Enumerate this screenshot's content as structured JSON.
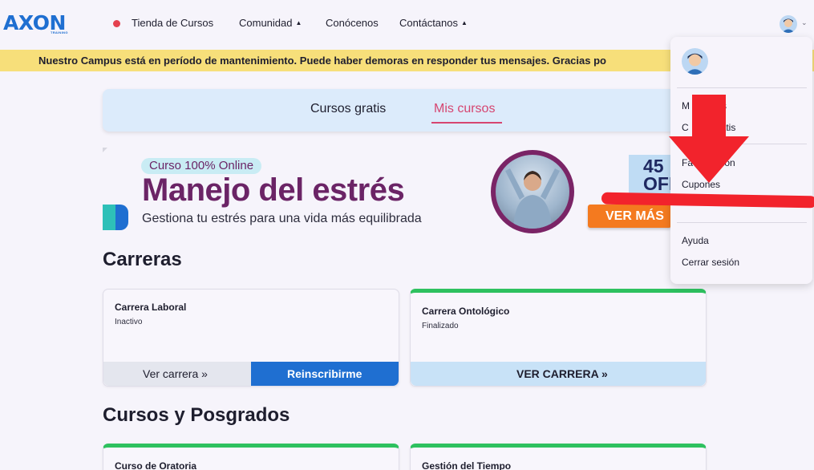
{
  "header": {
    "logo_text": "AXON",
    "logo_subtext": "TRAINING",
    "nav": [
      {
        "label": "Tienda de Cursos"
      },
      {
        "label": "Comunidad"
      },
      {
        "label": "Conócenos"
      },
      {
        "label": "Contáctanos"
      }
    ]
  },
  "banner": {
    "text": "Nuestro Campus está en período de mantenimiento. Puede haber demoras en responder tus mensajes. Gracias po"
  },
  "tabs": [
    {
      "label": "Cursos gratis",
      "active": false
    },
    {
      "label": "Mis cursos",
      "active": true
    }
  ],
  "promo": {
    "pill": "Curso 100% Online",
    "title": "Manejo del estrés",
    "subtitle": "Gestiona tu estrés para una vida más equilibrada",
    "discount_line1": "45",
    "discount_line2": "OFF",
    "cta": "VER MÁS"
  },
  "sections": {
    "careers_title": "Carreras",
    "courses_title": "Cursos y Posgrados"
  },
  "careers": [
    {
      "name": "Carrera Laboral",
      "status": "Inactivo",
      "btn_left": "Ver carrera »",
      "btn_right": "Reinscribirme"
    },
    {
      "name": "Carrera Ontológico",
      "status": "Finalizado",
      "btn": "VER CARRERA »"
    }
  ],
  "courses": [
    {
      "name": "Curso de Oratoria"
    },
    {
      "name": "Gestión del Tiempo"
    }
  ],
  "menu": {
    "items": [
      {
        "label": "M            s"
      },
      {
        "label": "C            atis"
      },
      {
        "label": "Fa           ión"
      },
      {
        "label": "Cupones"
      },
      {
        "label": "Ayuda"
      },
      {
        "label": "Cerrar sesión"
      }
    ]
  },
  "colors": {
    "brand_blue": "#1f6fd1",
    "accent_pink": "#d64570",
    "promo_purple": "#6b2466",
    "banner_yellow": "#f7df7a",
    "annotation_red": "#f2232c",
    "progress_green": "#2ec15f"
  }
}
